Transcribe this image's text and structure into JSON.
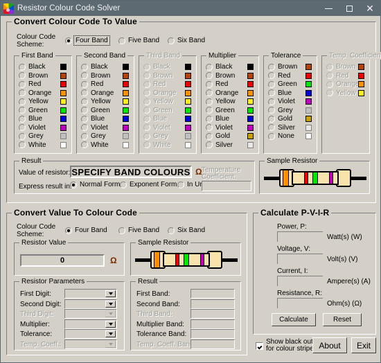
{
  "window": {
    "title": "Resistor Colour Code Solver",
    "icon": "palette-icon",
    "buttons": {
      "minimize": "–",
      "maximize": "□",
      "close": "✕"
    }
  },
  "section1": {
    "title": "Convert Colour Code To Value",
    "scheme_label_line1": "Colour Code",
    "scheme_label_line2": "Scheme:",
    "scheme_options": [
      "Four Band",
      "Five Band",
      "Six Band"
    ],
    "scheme_selected": "Four Band",
    "groups": [
      {
        "title": "First Band",
        "disabled": false,
        "items": [
          {
            "label": "Black",
            "color": "#000000",
            "selected": false
          },
          {
            "label": "Brown",
            "color": "#b5430a",
            "selected": false
          },
          {
            "label": "Red",
            "color": "#ee0000",
            "selected": false
          },
          {
            "label": "Orange",
            "color": "#ff9000",
            "selected": false
          },
          {
            "label": "Yellow",
            "color": "#ffee22",
            "selected": false
          },
          {
            "label": "Green",
            "color": "#00e800",
            "selected": false
          },
          {
            "label": "Blue",
            "color": "#0000dd",
            "selected": false
          },
          {
            "label": "Violet",
            "color": "#c000c0",
            "selected": false
          },
          {
            "label": "Grey",
            "color": "#c0c0c0",
            "selected": false
          },
          {
            "label": "White",
            "color": "#ffffff",
            "selected": false
          }
        ]
      },
      {
        "title": "Second Band",
        "disabled": false,
        "items": [
          {
            "label": "Black",
            "color": "#000000",
            "selected": false
          },
          {
            "label": "Brown",
            "color": "#b5430a",
            "selected": false
          },
          {
            "label": "Red",
            "color": "#ee0000",
            "selected": false
          },
          {
            "label": "Orange",
            "color": "#ff9000",
            "selected": false
          },
          {
            "label": "Yellow",
            "color": "#ffee22",
            "selected": false
          },
          {
            "label": "Green",
            "color": "#00e800",
            "selected": false
          },
          {
            "label": "Blue",
            "color": "#0000dd",
            "selected": false
          },
          {
            "label": "Violet",
            "color": "#c000c0",
            "selected": false
          },
          {
            "label": "Grey",
            "color": "#c0c0c0",
            "selected": false
          },
          {
            "label": "White",
            "color": "#ffffff",
            "selected": false
          }
        ]
      },
      {
        "title": "Third Band",
        "disabled": true,
        "items": [
          {
            "label": "Black",
            "color": "#000000",
            "selected": false
          },
          {
            "label": "Brown",
            "color": "#b5430a",
            "selected": false
          },
          {
            "label": "Red",
            "color": "#ee0000",
            "selected": false
          },
          {
            "label": "Orange",
            "color": "#ff9000",
            "selected": false
          },
          {
            "label": "Yellow",
            "color": "#ffee22",
            "selected": false
          },
          {
            "label": "Green",
            "color": "#00e800",
            "selected": false
          },
          {
            "label": "Blue",
            "color": "#0000dd",
            "selected": false
          },
          {
            "label": "Violet",
            "color": "#c000c0",
            "selected": false
          },
          {
            "label": "Grey",
            "color": "#c0c0c0",
            "selected": false
          },
          {
            "label": "White",
            "color": "#ffffff",
            "selected": false
          }
        ]
      },
      {
        "title": "Multiplier",
        "disabled": false,
        "items": [
          {
            "label": "Black",
            "color": "#000000",
            "selected": false
          },
          {
            "label": "Brown",
            "color": "#b5430a",
            "selected": false
          },
          {
            "label": "Red",
            "color": "#ee0000",
            "selected": false
          },
          {
            "label": "Orange",
            "color": "#ff9000",
            "selected": false
          },
          {
            "label": "Yellow",
            "color": "#ffee22",
            "selected": false
          },
          {
            "label": "Green",
            "color": "#00e800",
            "selected": false
          },
          {
            "label": "Blue",
            "color": "#0000dd",
            "selected": false
          },
          {
            "label": "Violet",
            "color": "#c000c0",
            "selected": false
          },
          {
            "label": "Gold",
            "color": "#c8a000",
            "selected": false
          },
          {
            "label": "Silver",
            "color": "#e8e8e8",
            "selected": false
          }
        ]
      },
      {
        "title": "Tolerance",
        "disabled": false,
        "items": [
          {
            "label": "Brown",
            "color": "#b5430a",
            "selected": false
          },
          {
            "label": "Red",
            "color": "#ee0000",
            "selected": false
          },
          {
            "label": "Green",
            "color": "#00e800",
            "selected": false
          },
          {
            "label": "Blue",
            "color": "#0000dd",
            "selected": false
          },
          {
            "label": "Violet",
            "color": "#c000c0",
            "selected": false
          },
          {
            "label": "Grey",
            "color": "#c0c0c0",
            "selected": false
          },
          {
            "label": "Gold",
            "color": "#c8a000",
            "selected": false
          },
          {
            "label": "Silver",
            "color": "#e8e8e8",
            "selected": false
          },
          {
            "label": "None",
            "color": "#ffffff",
            "selected": false
          }
        ]
      },
      {
        "title": "Temp. Coefficient",
        "disabled": true,
        "items": [
          {
            "label": "Brown",
            "color": "#b5430a",
            "selected": false
          },
          {
            "label": "Red",
            "color": "#ee0000",
            "selected": false
          },
          {
            "label": "Orange",
            "color": "#ff9000",
            "selected": false
          },
          {
            "label": "Yellow",
            "color": "#ffee22",
            "selected": false
          }
        ]
      }
    ],
    "result": {
      "title": "Result",
      "value_label": "Value of resistor:",
      "value_text": "SPECIFY BAND COLOURS",
      "ohm_symbol": "Ω",
      "express_label": "Express result in:",
      "express_options": [
        "Normal Form",
        "Exponent Form",
        "In Units"
      ],
      "express_selected": "Normal Form",
      "temp_label_line1": "Temperature",
      "temp_label_line2": "Coefficient:",
      "temp_value": ""
    },
    "sample": {
      "title": "Sample Resistor",
      "bands": [
        "#ff9000",
        "#ee0000",
        "#00e800",
        "#c000c0"
      ]
    }
  },
  "section2": {
    "title": "Convert Value To Colour Code",
    "scheme_label_line1": "Colour Code",
    "scheme_label_line2": "Scheme:",
    "scheme_options": [
      "Four Band",
      "Five Band",
      "Six Band"
    ],
    "scheme_selected": "Four Band",
    "resistor_value": {
      "title": "Resistor Value",
      "value": "0",
      "ohm_symbol": "Ω"
    },
    "sample": {
      "title": "Sample Resistor",
      "bands": [
        "#ff9000",
        "#ee0000",
        "#00e800",
        "#c000c0"
      ]
    },
    "parameters": {
      "title": "Resistor Parameters",
      "rows": [
        {
          "label": "First Digit:",
          "value": "",
          "disabled": false
        },
        {
          "label": "Second Digit:",
          "value": "",
          "disabled": false
        },
        {
          "label": "Third Digit:",
          "value": "",
          "disabled": true
        },
        {
          "label": "Multiplier:",
          "value": "",
          "disabled": false
        },
        {
          "label": "Tolerance:",
          "value": "",
          "disabled": false
        },
        {
          "label": "Temp. Coeff.:",
          "value": "",
          "disabled": true
        }
      ]
    },
    "result": {
      "title": "Result",
      "rows": [
        {
          "label": "First Band:",
          "value": "",
          "disabled": false
        },
        {
          "label": "Second Band:",
          "value": "",
          "disabled": false
        },
        {
          "label": "Third Band:",
          "value": "",
          "disabled": true
        },
        {
          "label": "Multiplier Band:",
          "value": "",
          "disabled": false
        },
        {
          "label": "Tolerance Band:",
          "value": "",
          "disabled": false
        },
        {
          "label": "Temp. Coeff. Band:",
          "value": "",
          "disabled": true
        }
      ]
    }
  },
  "section3": {
    "title": "Calculate P-V-I-R",
    "rows": [
      {
        "label": "Power, P:",
        "value": "",
        "unit": "Watt(s) (W)"
      },
      {
        "label": "Voltage, V:",
        "value": "",
        "unit": "Volt(s) (V)"
      },
      {
        "label": "Current, I:",
        "value": "",
        "unit": "Ampere(s) (A)"
      },
      {
        "label": "Resistance, R:",
        "value": "",
        "unit": "Ohm(s) (Ω)"
      }
    ],
    "calculate_label": "Calculate",
    "reset_label": "Reset"
  },
  "footer": {
    "checkbox_line1": "Show black outline",
    "checkbox_line2": "for colour stripes",
    "checkbox_checked": true,
    "about_label": "About",
    "exit_label": "Exit"
  }
}
